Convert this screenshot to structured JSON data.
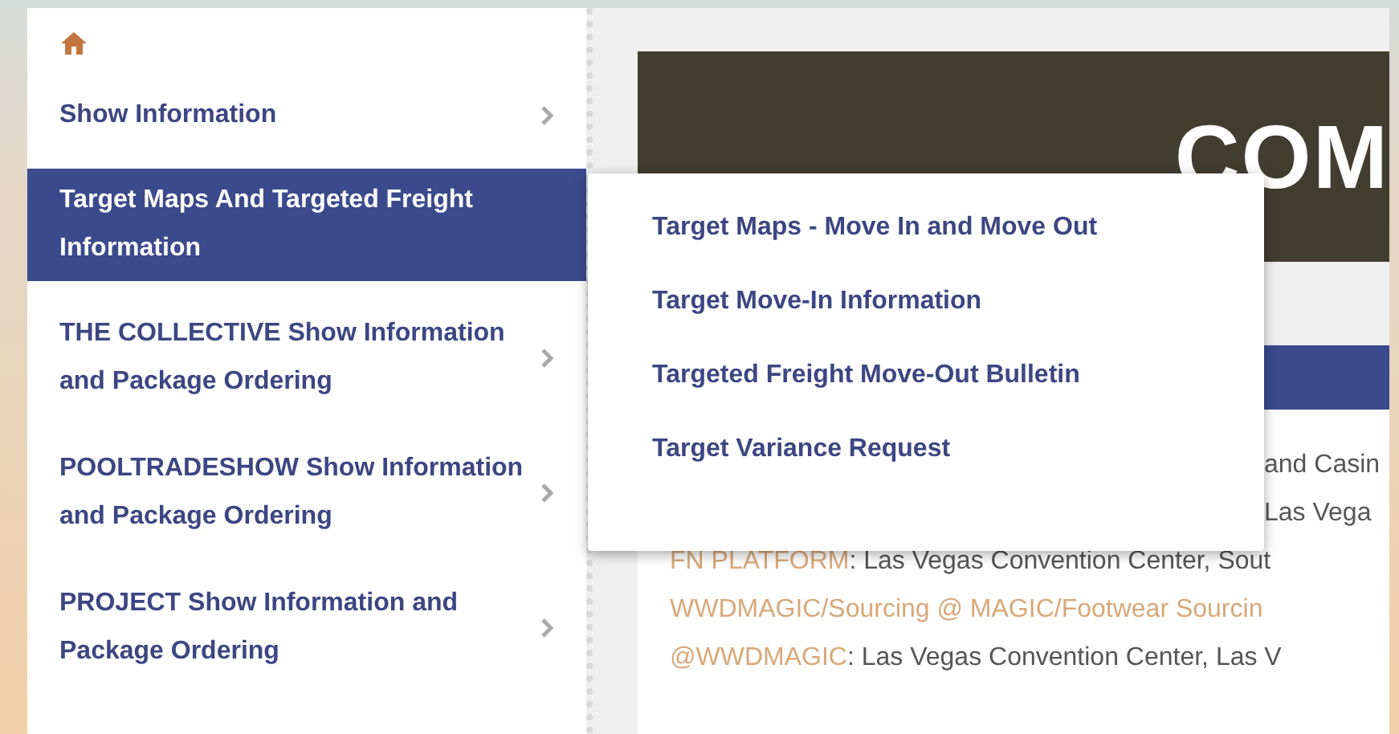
{
  "sidebar": {
    "items": [
      {
        "label": "Show Information",
        "selected": false,
        "has_submenu": true
      },
      {
        "label": "Target Maps And Targeted Freight Information",
        "selected": true,
        "has_submenu": false
      },
      {
        "label": "THE COLLECTIVE Show Information and Package Ordering",
        "selected": false,
        "has_submenu": true
      },
      {
        "label": "POOLTRADESHOW Show Information and Package Ordering",
        "selected": false,
        "has_submenu": true
      },
      {
        "label": "PROJECT Show Information and Package Ordering",
        "selected": false,
        "has_submenu": true
      }
    ]
  },
  "submenu": {
    "items": [
      "Target Maps - Move In and Move Out",
      "Target Move-In Information",
      "Targeted Freight Move-Out Bulletin",
      "Target Variance Request"
    ]
  },
  "banner": {
    "title": "COM"
  },
  "card": {
    "lines": [
      {
        "kind": "tail",
        "text": "and Casin"
      },
      {
        "kind": "tail",
        "text": "Las Vega"
      },
      {
        "kind": "full",
        "label": "FN PLATFORM",
        "text": ": Las Vegas Convention Center, Sout"
      },
      {
        "kind": "full",
        "label": "WWDMAGIC/Sourcing @ MAGIC/Footwear Sourcin"
      },
      {
        "kind": "full",
        "label": "@WWDMAGIC",
        "text": ": Las Vegas Convention Center, Las V"
      }
    ]
  }
}
